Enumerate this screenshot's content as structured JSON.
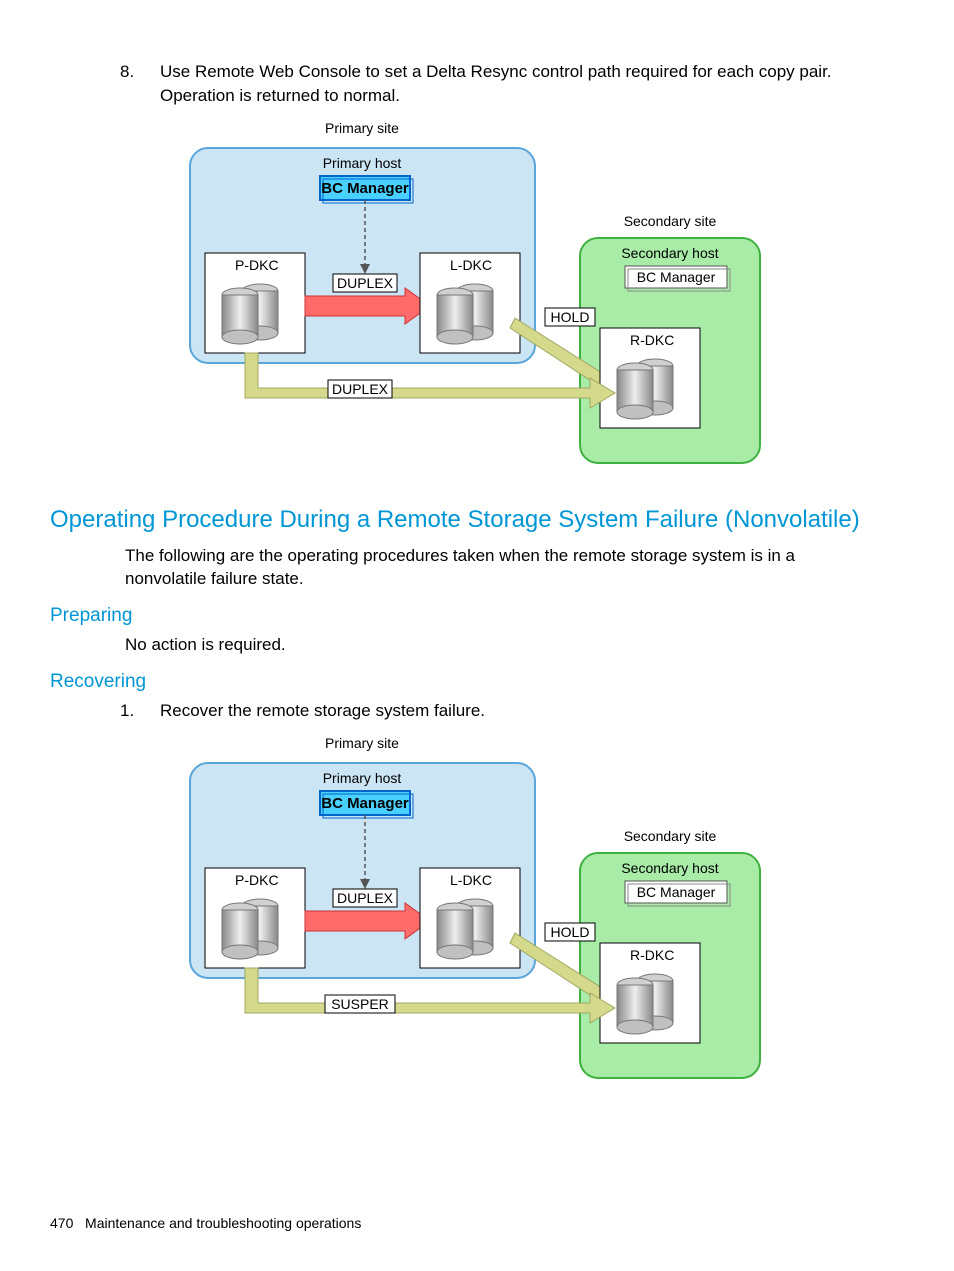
{
  "list8": {
    "num": "8.",
    "text": "Use Remote Web Console to set a Delta Resync control path required for each copy pair. Operation is returned to normal."
  },
  "heading_main": "Operating Procedure During a Remote Storage System Failure (Nonvolatile)",
  "intro": "The following are the operating procedures taken when the remote storage system is in a nonvolatile failure state.",
  "preparing": {
    "title": "Preparing",
    "text": "No action is required."
  },
  "recovering": {
    "title": "Recovering",
    "item1_num": "1.",
    "item1_text": "Recover the remote storage system failure."
  },
  "diagram1": {
    "primary_site": "Primary site",
    "primary_host": "Primary host",
    "bc_manager": "BC Manager",
    "secondary_site": "Secondary site",
    "secondary_host": "Secondary host",
    "pdkc": "P-DKC",
    "ldkc": "L-DKC",
    "rdkc": "R-DKC",
    "duplex1": "DUPLEX",
    "duplex2": "DUPLEX",
    "hold": "HOLD",
    "bottom_state": "DUPLEX"
  },
  "diagram2": {
    "primary_site": "Primary site",
    "primary_host": "Primary host",
    "bc_manager": "BC Manager",
    "secondary_site": "Secondary site",
    "secondary_host": "Secondary host",
    "pdkc": "P-DKC",
    "ldkc": "L-DKC",
    "rdkc": "R-DKC",
    "duplex1": "DUPLEX",
    "hold": "HOLD",
    "bottom_state": "SUSPER"
  },
  "footer": {
    "page": "470",
    "title": "Maintenance and troubleshooting operations"
  }
}
